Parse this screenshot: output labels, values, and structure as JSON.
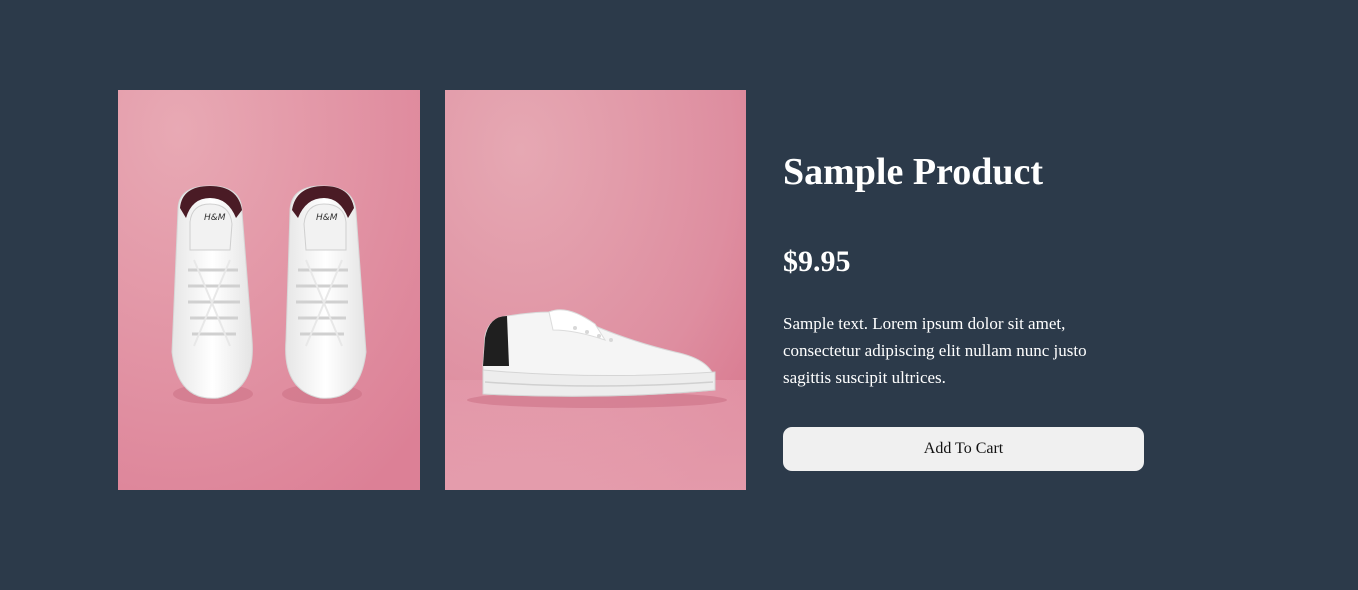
{
  "product": {
    "title": "Sample Product",
    "price": "$9.95",
    "description": "Sample text. Lorem ipsum dolor sit amet, consectetur adipiscing elit nullam nunc justo sagittis suscipit ultrices.",
    "add_to_cart_label": "Add To Cart"
  },
  "images": [
    {
      "subject": "pair of white sneakers, top view, pink background"
    },
    {
      "subject": "single white sneaker, side view, pink background"
    }
  ],
  "colors": {
    "page_background": "#2c3a4a",
    "photo_background": "#e28d9f",
    "button_background": "#f0f0f0",
    "text": "#ffffff"
  }
}
